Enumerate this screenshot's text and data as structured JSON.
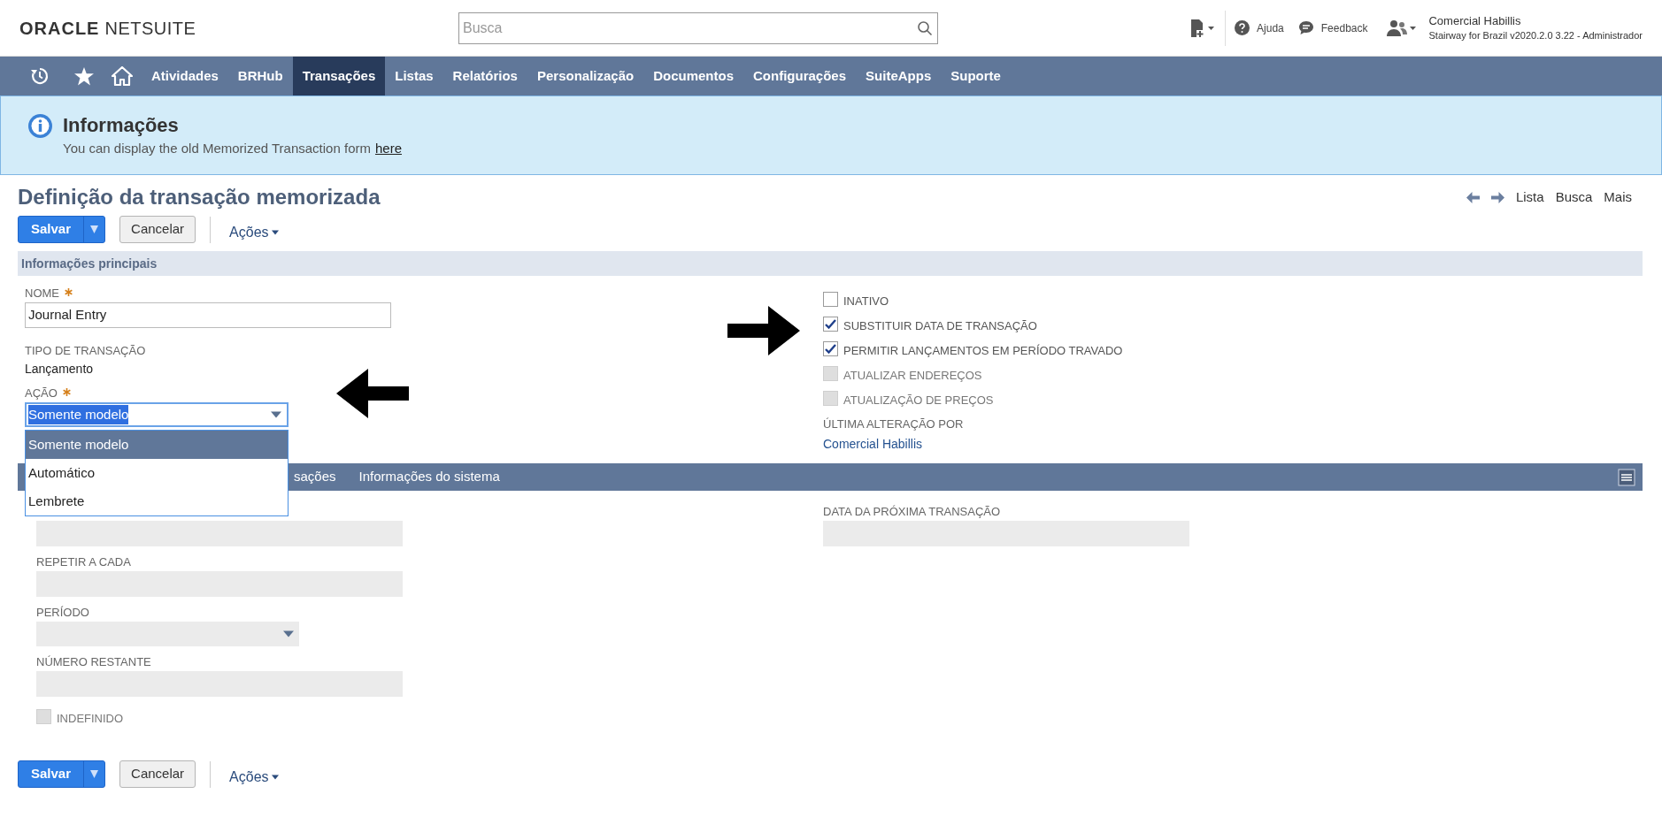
{
  "header": {
    "logo": {
      "brand": "ORACLE",
      "product": "NETSUITE"
    },
    "search": {
      "placeholder": "Busca"
    },
    "help": "Ajuda",
    "feedback": "Feedback",
    "user": {
      "name": "Comercial Habillis",
      "role": "Stairway for Brazil v2020.2.0 3.22 - Administrador"
    }
  },
  "nav": [
    {
      "label": "Atividades",
      "selected": false
    },
    {
      "label": "BRHub",
      "selected": false
    },
    {
      "label": "Transações",
      "selected": true
    },
    {
      "label": "Listas",
      "selected": false
    },
    {
      "label": "Relatórios",
      "selected": false
    },
    {
      "label": "Personalização",
      "selected": false
    },
    {
      "label": "Documentos",
      "selected": false
    },
    {
      "label": "Configurações",
      "selected": false
    },
    {
      "label": "SuiteApps",
      "selected": false
    },
    {
      "label": "Suporte",
      "selected": false
    }
  ],
  "banner": {
    "title": "Informações",
    "text": "You can display the old Memorized Transaction form",
    "link": "here"
  },
  "page": {
    "title": "Definição da transação memorizada",
    "links": [
      "Lista",
      "Busca",
      "Mais"
    ]
  },
  "button_bars": [
    {
      "save": "Salvar",
      "cancel": "Cancelar",
      "actions": "Ações"
    },
    {
      "save": "Salvar",
      "cancel": "Cancelar",
      "actions": "Ações"
    }
  ],
  "section": "Informações principais",
  "name_field": {
    "label": "NOME",
    "required": true,
    "value": "Journal Entry"
  },
  "type_field": {
    "label": "TIPO DE TRANSAÇÃO",
    "value": "Lançamento"
  },
  "action_field": {
    "label": "AÇÃO",
    "required": true,
    "value": "Somente modelo",
    "options": [
      {
        "label": "Somente modelo",
        "selected": true
      },
      {
        "label": "Automático",
        "selected": false
      },
      {
        "label": "Lembrete",
        "selected": false
      }
    ]
  },
  "checkboxes": [
    {
      "label": "INATIVO",
      "checked": false,
      "disabled": false
    },
    {
      "label": "SUBSTITUIR DATA DE TRANSAÇÃO",
      "checked": true,
      "disabled": false
    },
    {
      "label": "PERMITIR LANÇAMENTOS EM PERÍODO TRAVADO",
      "checked": true,
      "disabled": false
    },
    {
      "label": "ATUALIZAR ENDEREÇOS",
      "checked": false,
      "disabled": true
    },
    {
      "label": "ATUALIZAÇÃO DE PREÇOS",
      "checked": false,
      "disabled": true
    }
  ],
  "last_modified": {
    "label": "ÚLTIMA ALTERAÇÃO POR",
    "value": "Comercial Habillis"
  },
  "subtabs": [
    "sações",
    "Informações do sistema"
  ],
  "schedule_left": [
    {
      "kind": "text"
    },
    {
      "kind": "text",
      "label": "REPETIR A CADA"
    },
    {
      "kind": "select",
      "label": "PERÍODO"
    },
    {
      "kind": "text",
      "label": "NÚMERO RESTANTE"
    }
  ],
  "indefinite": {
    "label": "INDEFINIDO",
    "checked": false,
    "disabled": true
  },
  "schedule_right": [
    {
      "kind": "text",
      "label": "DATA DA PRÓXIMA TRANSAÇÃO"
    }
  ]
}
